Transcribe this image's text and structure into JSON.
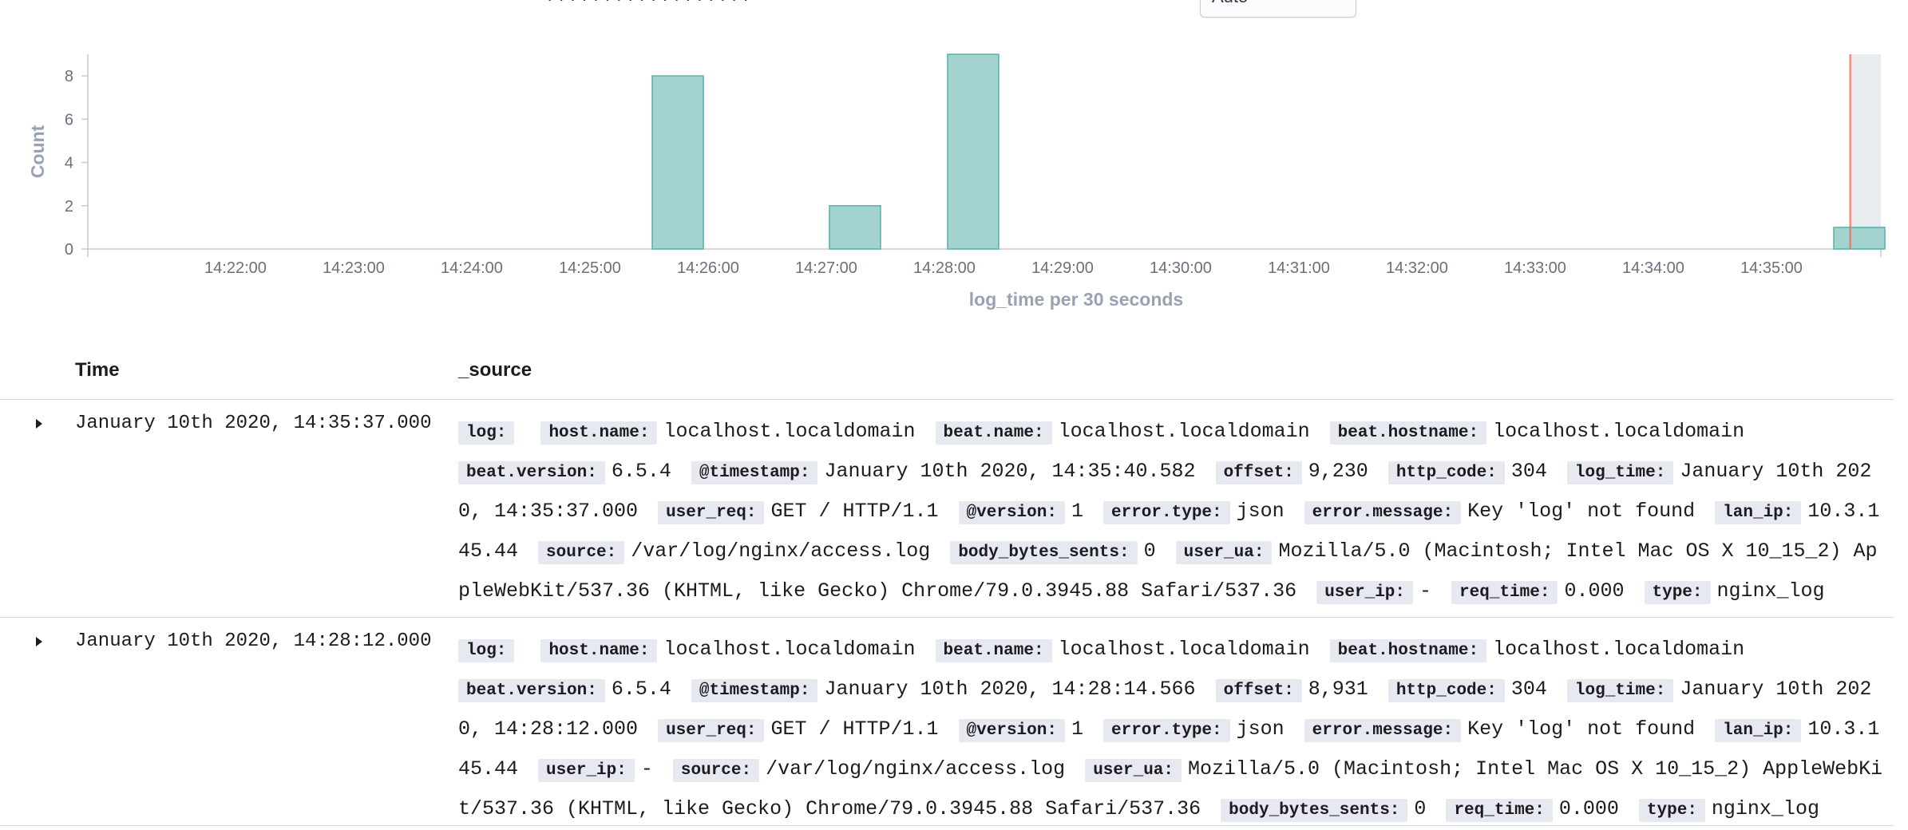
{
  "header": {
    "top_fragment": "· · · · · · · · · · · · · · · · · ·",
    "interval_value": "Auto"
  },
  "chart_data": {
    "type": "bar",
    "ylabel": "Count",
    "xlabel": "log_time per 30 seconds",
    "yticks": [
      0,
      2,
      4,
      6,
      8
    ],
    "ylim": [
      0,
      9
    ],
    "xticks": [
      "14:22:00",
      "14:23:00",
      "14:24:00",
      "14:25:00",
      "14:26:00",
      "14:27:00",
      "14:28:00",
      "14:29:00",
      "14:30:00",
      "14:31:00",
      "14:32:00",
      "14:33:00",
      "14:34:00",
      "14:35:00"
    ],
    "bars": [
      {
        "x": "14:25:30",
        "count": 8
      },
      {
        "x": "14:27:00",
        "count": 2
      },
      {
        "x": "14:28:00",
        "count": 9
      },
      {
        "x": "14:35:30",
        "count": 1
      }
    ],
    "now_marker": "14:35:40",
    "bar_color": "#a4d2cf",
    "bar_border_color": "#54b3ac",
    "now_marker_color": "#e7664c"
  },
  "table": {
    "col_time": "Time",
    "col_source": "_source"
  },
  "rows": [
    {
      "time": "January 10th 2020, 14:35:37.000",
      "fields": [
        {
          "k": "log:",
          "v": ""
        },
        {
          "k": "host.name:",
          "v": "localhost.localdomain"
        },
        {
          "k": "beat.name:",
          "v": "localhost.localdomain"
        },
        {
          "k": "beat.hostname:",
          "v": "localhost.localdomain"
        },
        {
          "k": "beat.version:",
          "v": "6.5.4"
        },
        {
          "k": "@timestamp:",
          "v": "January 10th 2020, 14:35:40.582"
        },
        {
          "k": "offset:",
          "v": "9,230"
        },
        {
          "k": "http_code:",
          "v": "304"
        },
        {
          "k": "log_time:",
          "v": "January 10th 2020, 14:35:37.000"
        },
        {
          "k": "user_req:",
          "v": "GET / HTTP/1.1"
        },
        {
          "k": "@version:",
          "v": "1"
        },
        {
          "k": "error.type:",
          "v": "json"
        },
        {
          "k": "error.message:",
          "v": "Key 'log' not found"
        },
        {
          "k": "lan_ip:",
          "v": "10.3.145.44"
        },
        {
          "k": "source:",
          "v": "/var/log/nginx/access.log"
        },
        {
          "k": "body_bytes_sents:",
          "v": "0"
        },
        {
          "k": "user_ua:",
          "v": "Mozilla/5.0 (Macintosh; Intel Mac OS X 10_15_2) AppleWebKit/537.36 (KHTML, like Gecko) Chrome/79.0.3945.88 Safari/537.36"
        },
        {
          "k": "user_ip:",
          "v": "-"
        },
        {
          "k": "req_time:",
          "v": "0.000"
        },
        {
          "k": "type:",
          "v": "nginx_log"
        }
      ]
    },
    {
      "time": "January 10th 2020, 14:28:12.000",
      "fields": [
        {
          "k": "log:",
          "v": ""
        },
        {
          "k": "host.name:",
          "v": "localhost.localdomain"
        },
        {
          "k": "beat.name:",
          "v": "localhost.localdomain"
        },
        {
          "k": "beat.hostname:",
          "v": "localhost.localdomain"
        },
        {
          "k": "beat.version:",
          "v": "6.5.4"
        },
        {
          "k": "@timestamp:",
          "v": "January 10th 2020, 14:28:14.566"
        },
        {
          "k": "offset:",
          "v": "8,931"
        },
        {
          "k": "http_code:",
          "v": "304"
        },
        {
          "k": "log_time:",
          "v": "January 10th 2020, 14:28:12.000"
        },
        {
          "k": "user_req:",
          "v": "GET / HTTP/1.1"
        },
        {
          "k": "@version:",
          "v": "1"
        },
        {
          "k": "error.type:",
          "v": "json"
        },
        {
          "k": "error.message:",
          "v": "Key 'log' not found"
        },
        {
          "k": "lan_ip:",
          "v": "10.3.145.44"
        },
        {
          "k": "user_ip:",
          "v": "-"
        },
        {
          "k": "source:",
          "v": "/var/log/nginx/access.log"
        },
        {
          "k": "user_ua:",
          "v": "Mozilla/5.0 (Macintosh; Intel Mac OS X 10_15_2) AppleWebKit/537.36 (KHTML, like Gecko) Chrome/79.0.3945.88 Safari/537.36"
        },
        {
          "k": "body_bytes_sents:",
          "v": "0"
        },
        {
          "k": "req_time:",
          "v": "0.000"
        },
        {
          "k": "type:",
          "v": "nginx_log"
        }
      ]
    }
  ],
  "icons": {
    "expand": "caret-right-icon",
    "select": "chevron-down-icon"
  }
}
